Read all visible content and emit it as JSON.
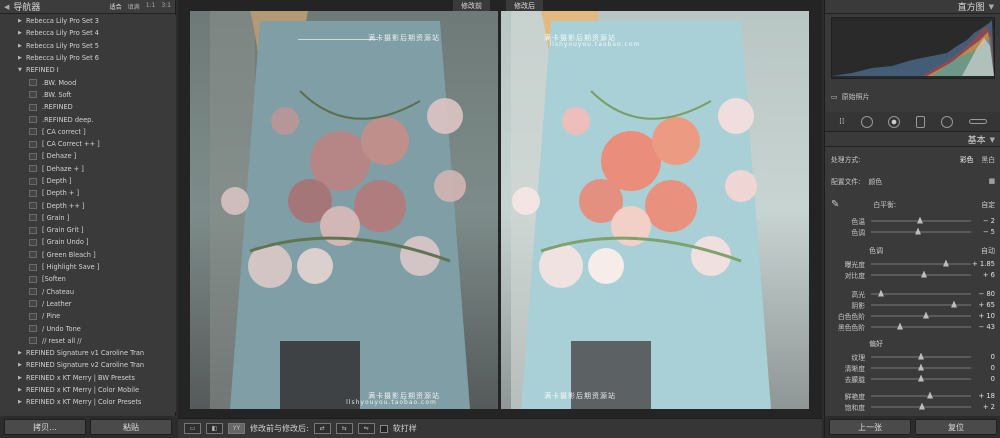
{
  "left_panel": {
    "title": "导航器",
    "zoom_options": [
      "适合",
      "填满",
      "1:1",
      "3:1"
    ],
    "presets": [
      {
        "type": "folder",
        "label": "Rebecca Lily Pro Set 3"
      },
      {
        "type": "folder",
        "label": "Rebecca Lily Pro Set 4"
      },
      {
        "type": "folder",
        "label": "Rebecca Lily Pro Set 5"
      },
      {
        "type": "folder",
        "label": "Rebecca Lily Pro Set 6"
      },
      {
        "type": "folder-open",
        "label": "REFINED I"
      },
      {
        "type": "item",
        "label": ".BW. Mood"
      },
      {
        "type": "item",
        "label": ".BW. Soft"
      },
      {
        "type": "item",
        "label": ".REFINED"
      },
      {
        "type": "item",
        "label": ".REFINED deep."
      },
      {
        "type": "item",
        "label": "[ CA correct ]"
      },
      {
        "type": "item",
        "label": "[ CA Correct ++ ]"
      },
      {
        "type": "item",
        "label": "[ Dehaze ]"
      },
      {
        "type": "item",
        "label": "[ Dehaze + ]"
      },
      {
        "type": "item",
        "label": "[ Depth ]"
      },
      {
        "type": "item",
        "label": "[ Depth + ]"
      },
      {
        "type": "item",
        "label": "[ Depth ++ ]"
      },
      {
        "type": "item",
        "label": "[ Grain ]"
      },
      {
        "type": "item",
        "label": "[ Grain Grit ]"
      },
      {
        "type": "item",
        "label": "[ Grain Undo ]"
      },
      {
        "type": "item",
        "label": "[ Green Bleach ]"
      },
      {
        "type": "item",
        "label": "[ Highlight Save ]"
      },
      {
        "type": "item",
        "label": "[Soften"
      },
      {
        "type": "item",
        "label": "/ Chateau"
      },
      {
        "type": "item",
        "label": "/ Leather"
      },
      {
        "type": "item",
        "label": "/ Pine"
      },
      {
        "type": "item",
        "label": "/ Undo Tone"
      },
      {
        "type": "item",
        "label": "// reset all //"
      },
      {
        "type": "folder",
        "label": "REFINED Signature v1 Caroline Tran"
      },
      {
        "type": "folder",
        "label": "REFINED Signature v2 Caroline Tran"
      },
      {
        "type": "folder",
        "label": "REFINED x KT Merry | BW Presets"
      },
      {
        "type": "folder",
        "label": "REFINED x KT Merry | Color Mobile"
      },
      {
        "type": "folder",
        "label": "REFINED x KT Merry | Color Presets"
      }
    ],
    "copy_button": "拷贝...",
    "paste_button": "粘贴"
  },
  "center": {
    "before_label": "修改前",
    "after_label": "修改后",
    "watermark_top": "满卡摄影后期资源站",
    "watermark_url": "llshyouyou.taobao.com",
    "toolbar_label": "修改前与修改后:",
    "soft_proof_label": "软打样"
  },
  "right_panel": {
    "histogram_title": "直方图",
    "original_photo_label": "原始照片",
    "basic_title": "基本",
    "treatment_label": "处理方式:",
    "treatment_color": "彩色",
    "treatment_bw": "黑白",
    "profile_label": "配置文件:",
    "profile_value": "颜色",
    "wb_label": "白平衡:",
    "wb_value": "自定",
    "tone_section": "色调",
    "tone_auto": "自动",
    "presence_section": "偏好",
    "prev_button": "上一张",
    "reset_button": "复位",
    "sliders_wb": [
      {
        "label": "色温",
        "value": "− 2",
        "pos": 0.49
      },
      {
        "label": "色调",
        "value": "− 5",
        "pos": 0.47
      }
    ],
    "sliders_tone_a": [
      {
        "label": "曝光度",
        "value": "+ 1.85",
        "pos": 0.75
      },
      {
        "label": "对比度",
        "value": "+ 6",
        "pos": 0.53
      }
    ],
    "sliders_tone_b": [
      {
        "label": "高光",
        "value": "− 80",
        "pos": 0.1
      },
      {
        "label": "阴影",
        "value": "+ 65",
        "pos": 0.83
      },
      {
        "label": "白色色阶",
        "value": "+ 10",
        "pos": 0.55
      },
      {
        "label": "黑色色阶",
        "value": "− 43",
        "pos": 0.29
      }
    ],
    "sliders_presence_a": [
      {
        "label": "纹理",
        "value": "0",
        "pos": 0.5
      },
      {
        "label": "清晰度",
        "value": "0",
        "pos": 0.5
      },
      {
        "label": "去朦胧",
        "value": "0",
        "pos": 0.5
      }
    ],
    "sliders_presence_b": [
      {
        "label": "鲜艳度",
        "value": "+ 18",
        "pos": 0.59
      },
      {
        "label": "饱和度",
        "value": "+ 2",
        "pos": 0.51
      }
    ]
  }
}
